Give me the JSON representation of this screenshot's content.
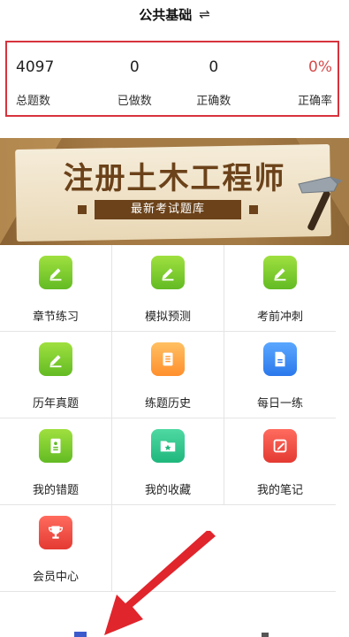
{
  "header": {
    "title": "公共基础",
    "swap_icon": "⇌"
  },
  "stats": [
    {
      "value": "4097",
      "label": "总题数"
    },
    {
      "value": "0",
      "label": "已做数"
    },
    {
      "value": "0",
      "label": "正确数"
    },
    {
      "value": "0%",
      "label": "正确率"
    }
  ],
  "banner": {
    "title": "注册土木工程师",
    "subtitle": "最新考试题库"
  },
  "menu": [
    {
      "label": "章节练习",
      "icon": "pencil-icon",
      "color": "#7fcf2f"
    },
    {
      "label": "模拟预测",
      "icon": "pencil-icon",
      "color": "#7fcf2f"
    },
    {
      "label": "考前冲刺",
      "icon": "pencil-icon",
      "color": "#7fcf2f"
    },
    {
      "label": "历年真题",
      "icon": "pencil-icon",
      "color": "#7fcf2f"
    },
    {
      "label": "练题历史",
      "icon": "document-icon",
      "color": "#ffa63c"
    },
    {
      "label": "每日一练",
      "icon": "file-icon",
      "color": "#3d8ff5"
    },
    {
      "label": "我的错题",
      "icon": "notebook-icon",
      "color": "#7fcf2f"
    },
    {
      "label": "我的收藏",
      "icon": "star-folder-icon",
      "color": "#2cc38b"
    },
    {
      "label": "我的笔记",
      "icon": "note-pencil-icon",
      "color": "#ef4a3f"
    },
    {
      "label": "会员中心",
      "icon": "trophy-icon",
      "color": "#ef4a3f"
    }
  ],
  "colors": {
    "highlight_border": "#d7333d",
    "accent_red": "#d64b4b",
    "arrow": "#e0252c"
  }
}
